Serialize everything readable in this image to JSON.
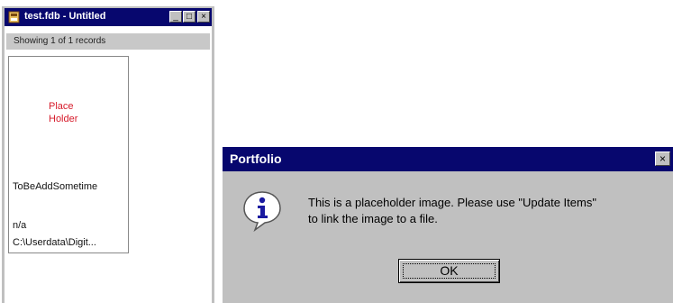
{
  "left_window": {
    "title": "test.fdb - Untitled",
    "status": "Showing 1 of 1 records",
    "record": {
      "placeholder_text": "Place\nHolder",
      "field_1": "ToBeAddSometime",
      "field_2": "n/a",
      "field_3": "C:\\Userdata\\Digit..."
    },
    "title_buttons": {
      "minimize": "_",
      "maximize": "□",
      "close": "×"
    }
  },
  "dialog": {
    "title": "Portfolio",
    "close_label": "×",
    "message_line_1": "This is a placeholder image. Please use \"Update Items\"",
    "message_line_2": "to link the image to a file.",
    "ok_label": "OK",
    "icon": "info-icon"
  },
  "colors": {
    "titlebar": "#07076e",
    "window_face": "#c0c0c0",
    "placeholder_text": "#d61a2a"
  }
}
